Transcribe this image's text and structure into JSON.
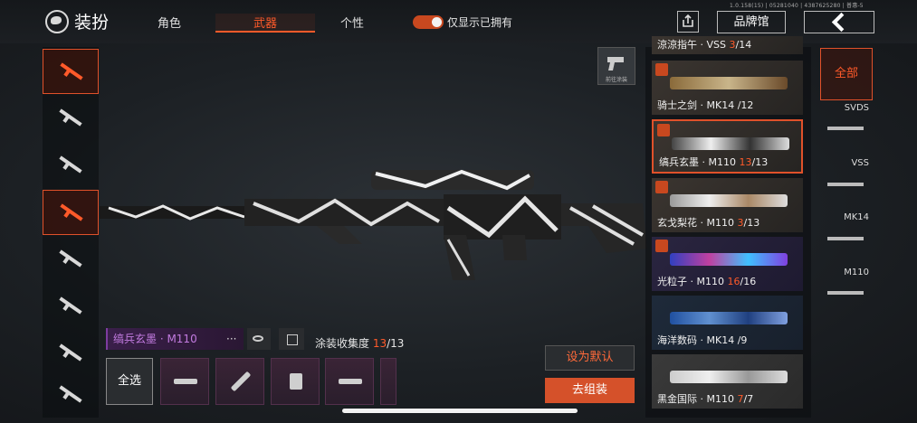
{
  "header": {
    "title": "装扮",
    "tabs": [
      {
        "label": "角色"
      },
      {
        "label": "武器"
      },
      {
        "label": "个性"
      }
    ],
    "active_tab": "武器",
    "only_owned_label": "仅显示已拥有",
    "only_owned_on": true,
    "version_text": "1.0.158(15) | 05281040 | 4387625280 | 普惠-5",
    "brand_label": "品牌馆"
  },
  "icons": {
    "logo": "globe-logo-icon",
    "share": "share-icon",
    "back": "back-arrow-icon",
    "go_paint": "spray-gun-icon",
    "eye": "eye-icon"
  },
  "go_paint_label": "前往涂装",
  "sidebar": {
    "items": [
      {
        "icon": "pistol-icon",
        "active": false
      },
      {
        "icon": "assault-rifle-icon",
        "active": false
      },
      {
        "icon": "smg-icon",
        "active": false
      },
      {
        "icon": "sniper-rifle-icon",
        "active": true
      },
      {
        "icon": "shotgun-icon",
        "active": false
      },
      {
        "icon": "rifle-icon",
        "active": false
      },
      {
        "icon": "dmr-icon",
        "active": false
      },
      {
        "icon": "lmg-icon",
        "active": false
      }
    ]
  },
  "skins": [
    {
      "name": "涼涼指午 · VSS",
      "current": "3",
      "total": "14"
    },
    {
      "name": "骑士之剑 · MK14",
      "current": "",
      "total": "12"
    },
    {
      "name": "缟兵玄墨 · M110",
      "current": "13",
      "total": "13"
    },
    {
      "name": "玄戈梨花 · M110",
      "current": "3",
      "total": "13"
    },
    {
      "name": "光粒子 · M110",
      "current": "16",
      "total": "16"
    },
    {
      "name": "海洋数码 · MK14",
      "current": "",
      "total": "9"
    },
    {
      "name": "黑金国际 · M110",
      "current": "7",
      "total": "7"
    }
  ],
  "filters": {
    "all_label": "全部",
    "guns": [
      "SVDS",
      "VSS",
      "MK14",
      "M110"
    ]
  },
  "selected_skin_name": "缟兵玄墨 · M110",
  "more_label": "···",
  "collection": {
    "label": "涂装收集度",
    "current": "13",
    "total": "13"
  },
  "select_all_label": "全选",
  "set_default_label": "设为默认",
  "go_assemble_label": "去组装",
  "colors": {
    "accent": "#ff5a2a",
    "purple": "#c27be0"
  }
}
